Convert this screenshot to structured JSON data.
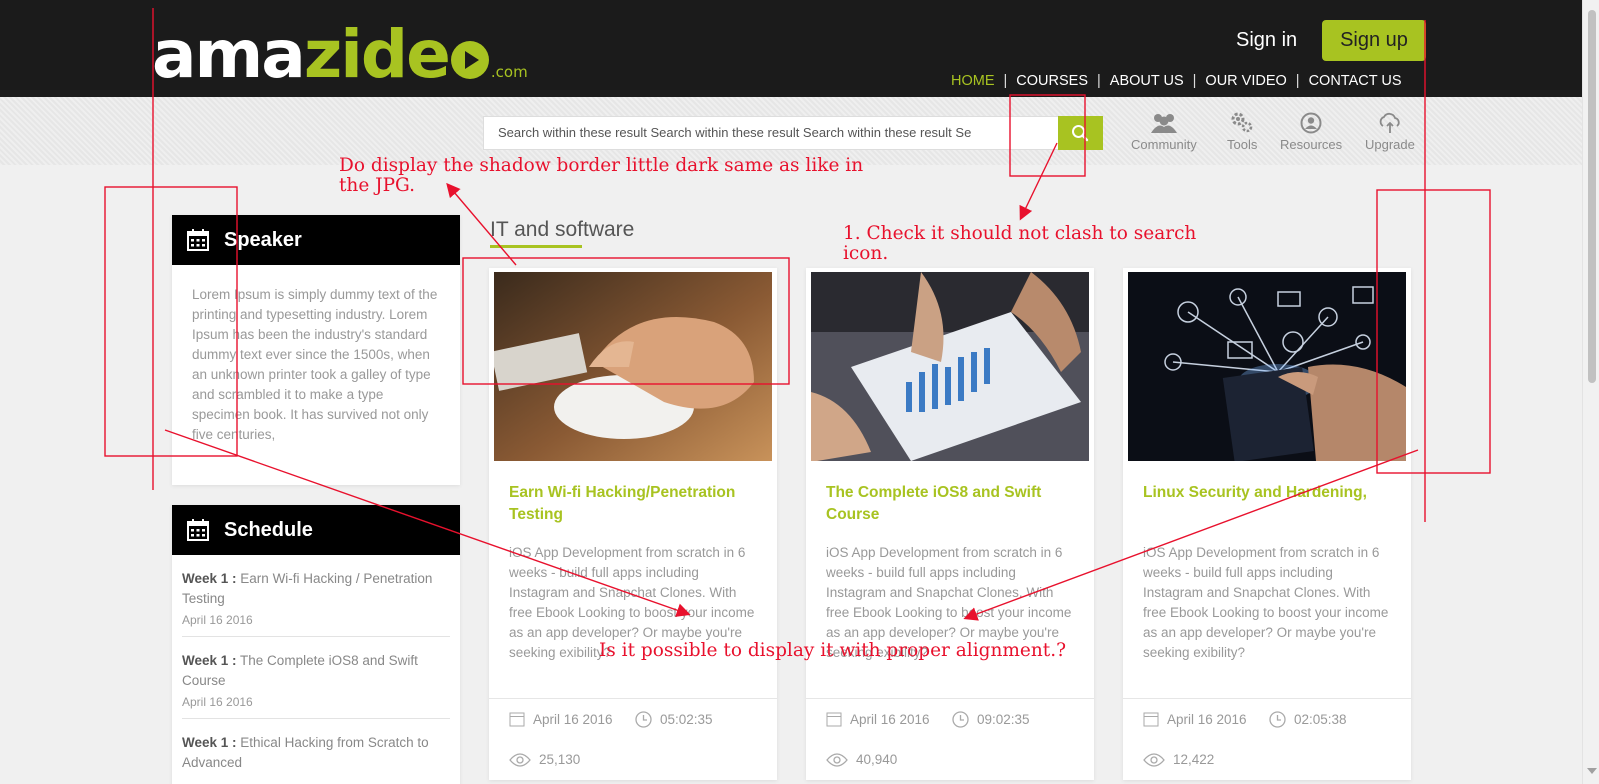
{
  "brand": {
    "main": "ama",
    "accent": "zide",
    "suffix": ".com",
    "color": "#a8c321"
  },
  "auth": {
    "signin": "Sign in",
    "signup": "Sign up"
  },
  "nav": [
    "HOME",
    "COURSES",
    "ABOUT US",
    "OUR VIDEO",
    "CONTACT US"
  ],
  "search": {
    "value": "Search within these result Search within these result Search within these result Se"
  },
  "tools": [
    {
      "label": "Community",
      "icon": "community-icon"
    },
    {
      "label": "Tools",
      "icon": "gears-icon"
    },
    {
      "label": "Resources",
      "icon": "resources-icon"
    },
    {
      "label": "Upgrade",
      "icon": "upgrade-icon"
    }
  ],
  "speaker": {
    "title": "Speaker",
    "text": "Lorem Ipsum is simply dummy text of the printing and typesetting industry. Lorem Ipsum has been the industry's standard dummy text ever since the 1500s, when an unknown printer took a galley of type and scrambled it to make a type specimen book. It has survived not only five centuries,"
  },
  "schedule": {
    "title": "Schedule",
    "weeks": [
      {
        "week": "Week 1 :",
        "title": "Earn Wi-fi Hacking / Penetration Testing",
        "date": "April 16 2016"
      },
      {
        "week": "Week 1 :",
        "title": "The Complete iOS8 and Swift Course",
        "date": "April 16 2016"
      },
      {
        "week": "Week 1 :",
        "title": "Ethical Hacking from Scratch to Advanced",
        "date": ""
      }
    ]
  },
  "section_title": "IT and software",
  "courses": [
    {
      "title": "Earn Wi-fi Hacking/Penetration Testing",
      "desc": "iOS App Development from scratch in 6 weeks - build full apps including Instagram and Snapchat Clones. With free Ebook Looking to boost your income as an app developer? Or maybe you're seeking exibility?",
      "date": "April 16 2016",
      "time": "05:02:35",
      "views": "25,130"
    },
    {
      "title": "The Complete iOS8 and Swift Course",
      "desc": "iOS App Development from scratch in 6 weeks - build full apps including Instagram and Snapchat Clones. With free Ebook Looking to boost your income as an app developer? Or maybe you're seeking exibility?",
      "date": "April 16 2016",
      "time": "09:02:35",
      "views": "40,940"
    },
    {
      "title": "Linux Security and Hardening,",
      "desc": "iOS App Development from scratch in 6 weeks - build full apps including Instagram and Snapchat Clones. With free Ebook Looking to boost your income as an app developer? Or maybe you're seeking exibility?",
      "date": "April 16 2016",
      "time": "02:05:38",
      "views": "12,422"
    }
  ],
  "annotations": {
    "shadow": "Do display the shadow border little dark same as like in the JPG.",
    "search": "1. Check it should not clash to search icon.",
    "align": "Is it possible to display it with proper alignment.?"
  }
}
